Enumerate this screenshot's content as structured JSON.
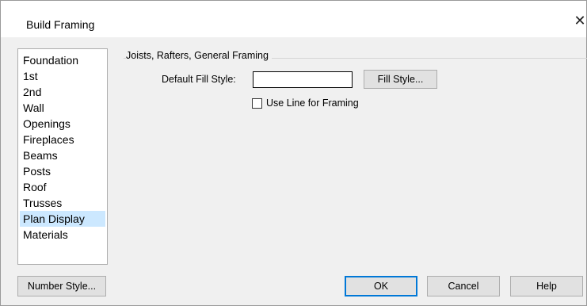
{
  "window": {
    "title": "Build Framing",
    "close_glyph": "✕"
  },
  "categories": [
    {
      "label": "Foundation",
      "selected": false
    },
    {
      "label": "1st",
      "selected": false
    },
    {
      "label": "2nd",
      "selected": false
    },
    {
      "label": "Wall",
      "selected": false
    },
    {
      "label": "Openings",
      "selected": false
    },
    {
      "label": "Fireplaces",
      "selected": false
    },
    {
      "label": "Beams",
      "selected": false
    },
    {
      "label": "Posts",
      "selected": false
    },
    {
      "label": "Roof",
      "selected": false
    },
    {
      "label": "Trusses",
      "selected": false
    },
    {
      "label": "Plan Display",
      "selected": true
    },
    {
      "label": "Materials",
      "selected": false
    }
  ],
  "panel": {
    "group_title": "Joists, Rafters, General Framing",
    "fill_style_label": "Default Fill Style:",
    "fill_style_value": "",
    "fill_style_button": "Fill Style...",
    "use_line_label": "Use Line for Framing",
    "use_line_checked": false
  },
  "footer": {
    "number_style_button": "Number Style...",
    "ok_button": "OK",
    "cancel_button": "Cancel",
    "help_button": "Help"
  },
  "colors": {
    "selection": "#cce8ff",
    "default_button_border": "#0078d7"
  }
}
